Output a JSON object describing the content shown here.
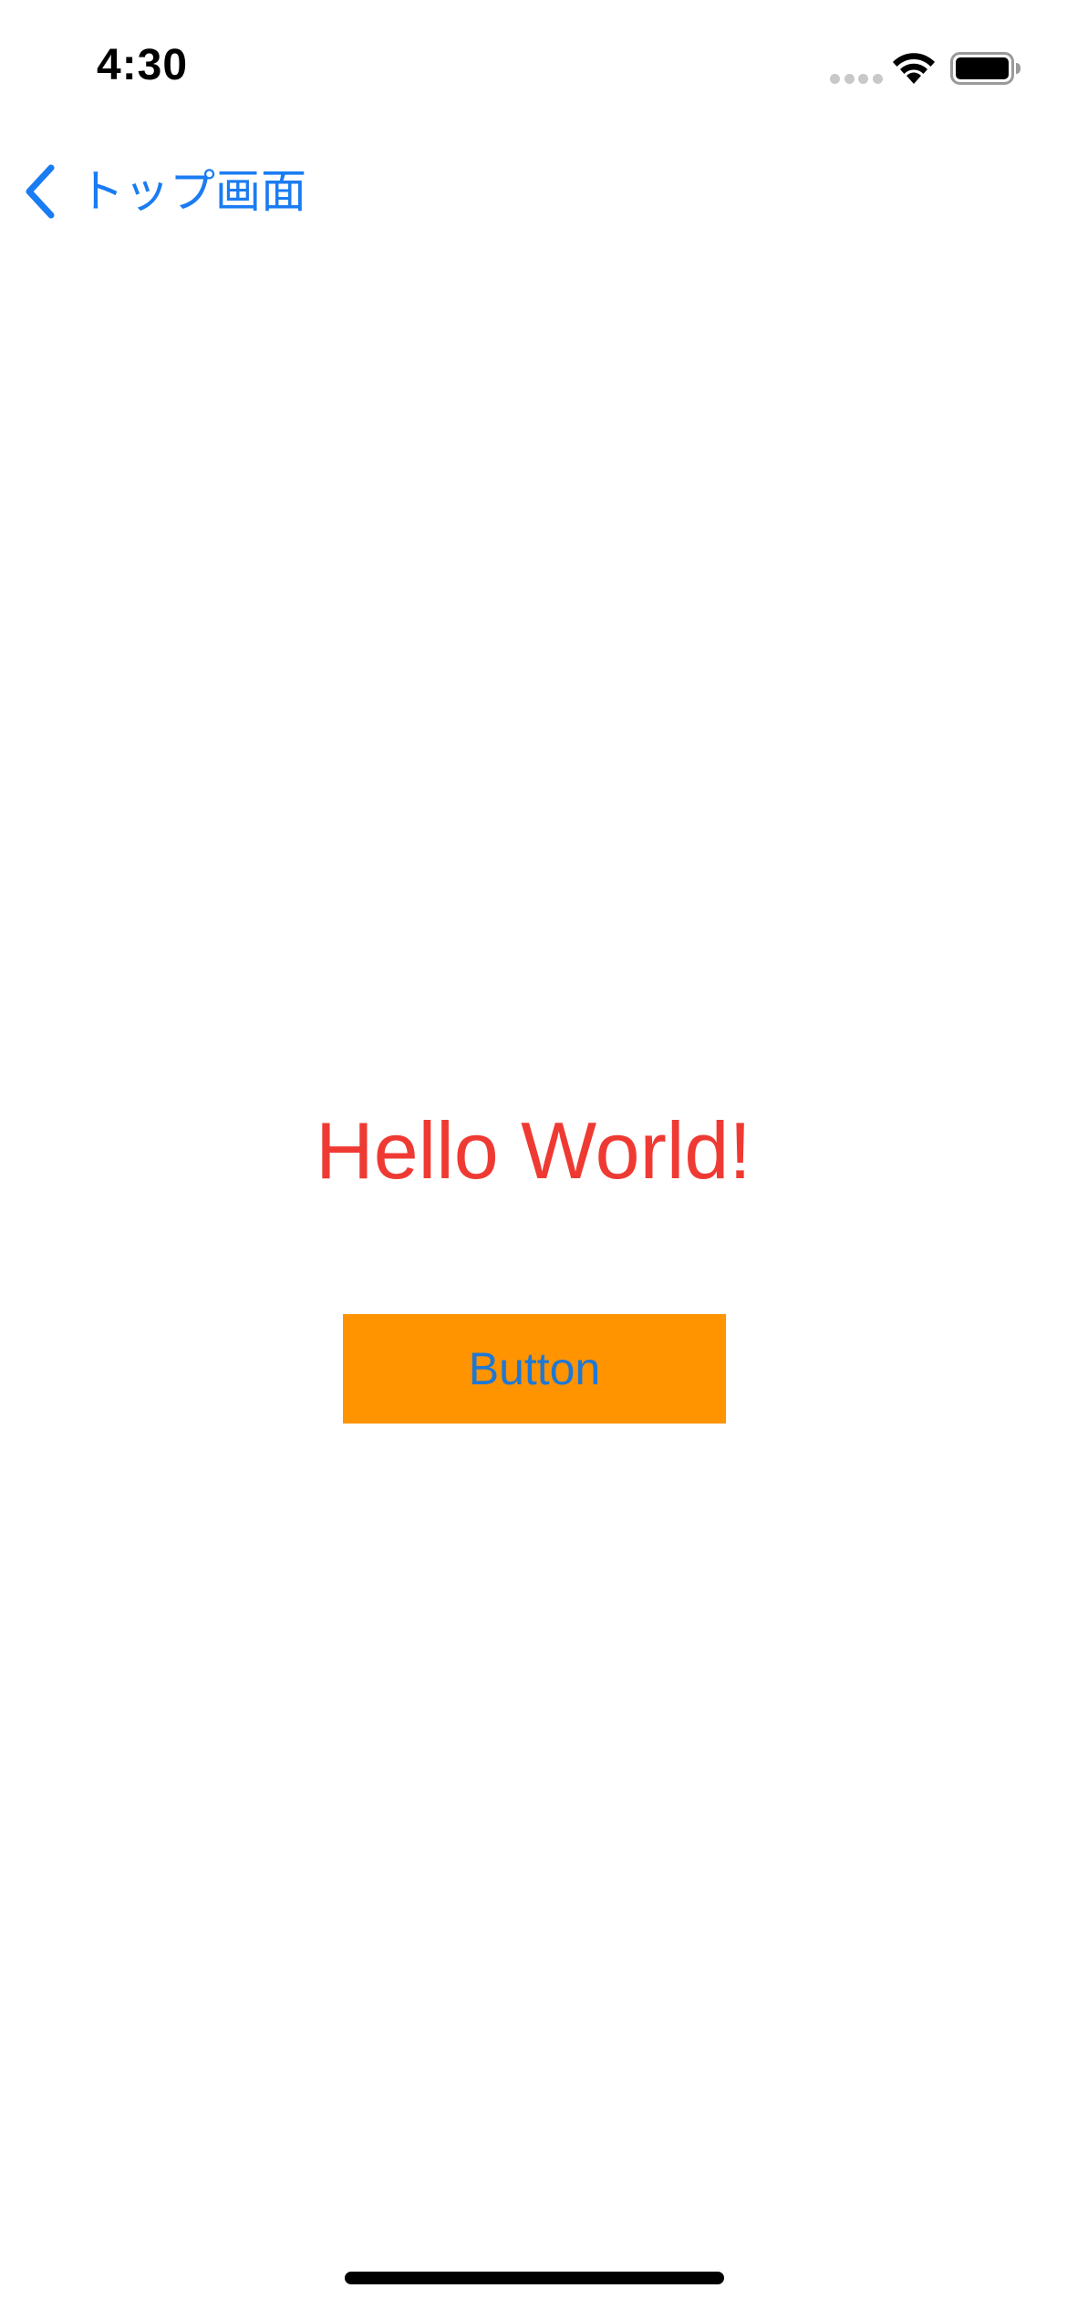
{
  "status_bar": {
    "time": "4:30",
    "icons": [
      "signal-dots-icon",
      "wifi-icon",
      "battery-icon"
    ]
  },
  "nav": {
    "back_icon": "chevron-left-icon",
    "back_label": "トップ画面"
  },
  "main": {
    "hello_text": "Hello World!",
    "button_label": "Button"
  },
  "colors": {
    "nav_tint": "#1a7cf2",
    "hello_text": "#ef3a33",
    "button_background": "#ff9300",
    "button_text": "#1e78d6"
  }
}
